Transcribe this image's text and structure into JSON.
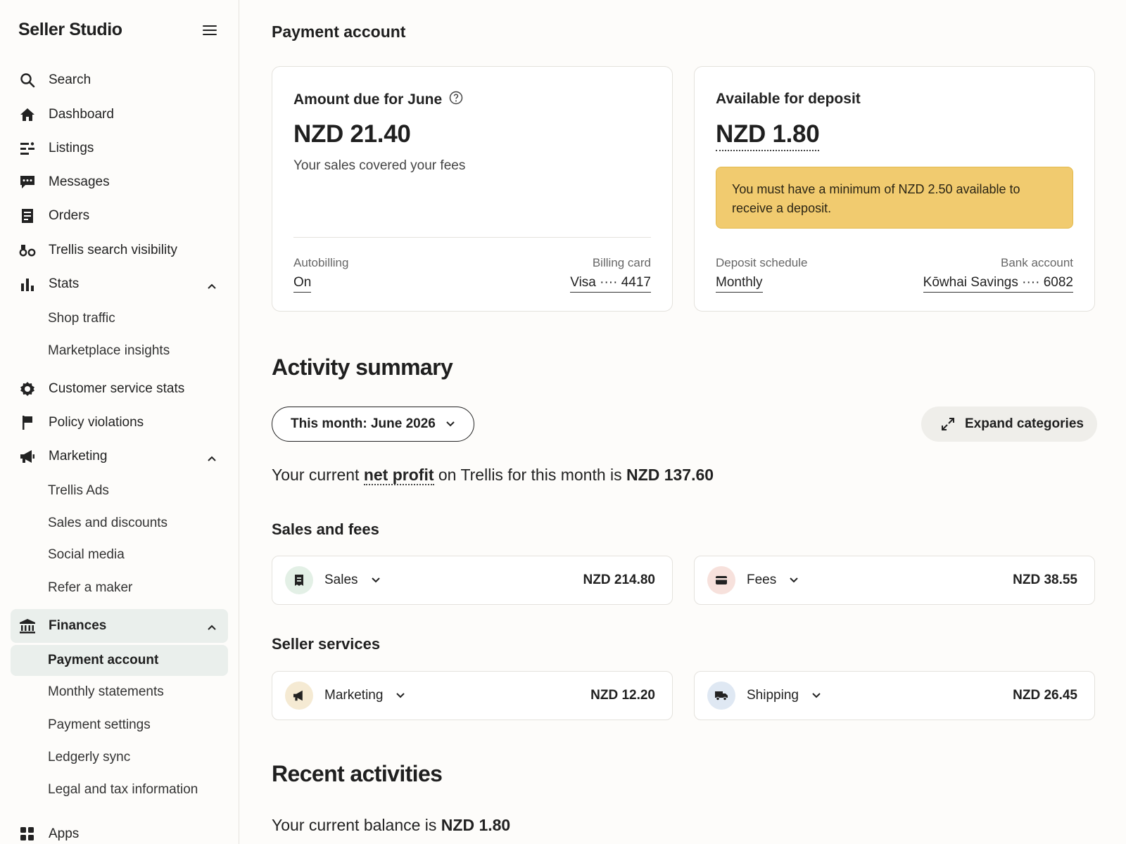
{
  "sidebar": {
    "brand": "Seller Studio",
    "items": [
      {
        "label": "Search",
        "icon": "search-icon"
      },
      {
        "label": "Dashboard",
        "icon": "home-icon"
      },
      {
        "label": "Listings",
        "icon": "listings-icon"
      },
      {
        "label": "Messages",
        "icon": "message-icon"
      },
      {
        "label": "Orders",
        "icon": "orders-icon"
      },
      {
        "label": "Trellis search visibility",
        "icon": "visibility-icon"
      },
      {
        "label": "Stats",
        "icon": "bar-chart-icon"
      },
      {
        "label": "Customer service stats",
        "icon": "gear-badge-icon"
      },
      {
        "label": "Policy violations",
        "icon": "flag-icon"
      },
      {
        "label": "Marketing",
        "icon": "megaphone-icon"
      },
      {
        "label": "Finances",
        "icon": "bank-icon"
      },
      {
        "label": "Apps",
        "icon": "apps-grid-icon"
      }
    ],
    "stats_sub": [
      "Shop traffic",
      "Marketplace insights"
    ],
    "marketing_sub": [
      "Trellis Ads",
      "Sales and discounts",
      "Social media",
      "Refer a maker"
    ],
    "finances_sub": [
      "Payment account",
      "Monthly statements",
      "Payment settings",
      "Ledgerly sync",
      "Legal and tax information"
    ]
  },
  "page": {
    "title": "Payment account"
  },
  "amount_due": {
    "label": "Amount due for June",
    "amount": "NZD 21.40",
    "subtitle": "Your sales covered your fees",
    "autobilling_label": "Autobilling",
    "autobilling_value": "On",
    "billing_card_label": "Billing card",
    "billing_card_value": "Visa ···· 4417"
  },
  "deposit": {
    "label": "Available for deposit",
    "amount": "NZD 1.80",
    "notice": "You must have a minimum of NZD 2.50 available to receive a deposit.",
    "schedule_label": "Deposit schedule",
    "schedule_value": "Monthly",
    "bank_label": "Bank account",
    "bank_value": "Kōwhai Savings ···· 6082"
  },
  "activity": {
    "title": "Activity summary",
    "period": "This month: June 2026",
    "expand_label": "Expand categories",
    "net_profit_prefix": "Your current",
    "net_profit_term": "net profit",
    "net_profit_middle": "on Trellis for this month is",
    "net_profit_amount": "NZD 137.60"
  },
  "sales_and_fees": {
    "title": "Sales and fees",
    "items": [
      {
        "name": "Sales",
        "amount": "NZD 214.80",
        "icon": "receipt-icon",
        "color": "#e3f0e6"
      },
      {
        "name": "Fees",
        "amount": "NZD 38.55",
        "icon": "card-icon",
        "color": "#f7e1dc"
      }
    ]
  },
  "seller_services": {
    "title": "Seller services",
    "items": [
      {
        "name": "Marketing",
        "amount": "NZD 12.20",
        "icon": "megaphone-icon",
        "color": "#f5ead3"
      },
      {
        "name": "Shipping",
        "amount": "NZD 26.45",
        "icon": "truck-icon",
        "color": "#dfe8f3"
      }
    ]
  },
  "recent": {
    "title": "Recent activities",
    "balance_prefix": "Your current balance is",
    "balance_amount": "NZD 1.80"
  }
}
